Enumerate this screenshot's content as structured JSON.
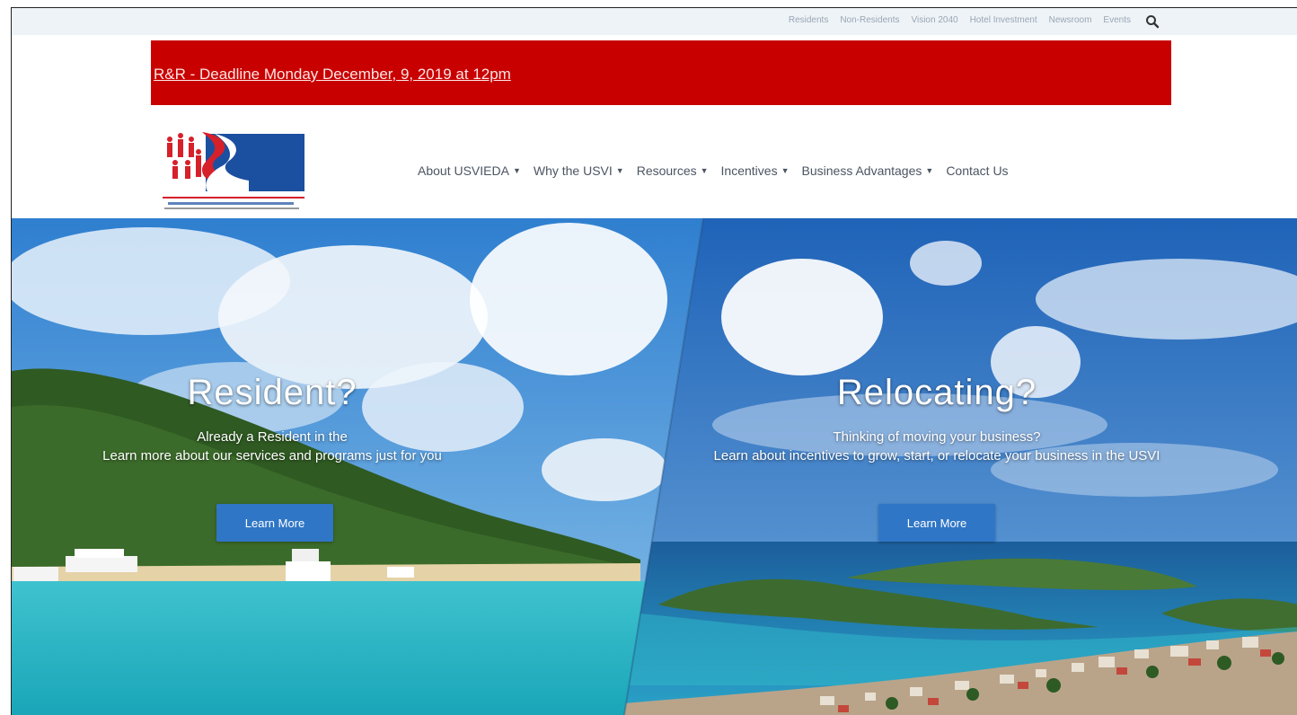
{
  "utility_nav": [
    "Residents",
    "Non-Residents",
    "Vision 2040",
    "Hotel Investment",
    "Newsroom",
    "Events"
  ],
  "alert": {
    "text": "R&R - Deadline Monday December, 9, 2019 at 12pm"
  },
  "main_nav": [
    {
      "label": "About USVIEDA",
      "dropdown": true
    },
    {
      "label": "Why the USVI",
      "dropdown": true
    },
    {
      "label": "Resources",
      "dropdown": true
    },
    {
      "label": "Incentives",
      "dropdown": true
    },
    {
      "label": "Business Advantages",
      "dropdown": true
    },
    {
      "label": "Contact Us",
      "dropdown": false
    }
  ],
  "hero": {
    "left": {
      "title": "Resident?",
      "line1": "Already a Resident in the",
      "line2": "Learn more about our services and programs just for you",
      "button": "Learn More"
    },
    "right": {
      "title": "Relocating?",
      "line1": "Thinking of moving your business?",
      "line2": "Learn about incentives to grow, start, or relocate your business in the USVI",
      "button": "Learn More"
    }
  },
  "colors": {
    "alert_bg": "#c80000",
    "button": "#2f76c6",
    "logo_blue": "#1b4fa0",
    "logo_red": "#d6202a"
  }
}
